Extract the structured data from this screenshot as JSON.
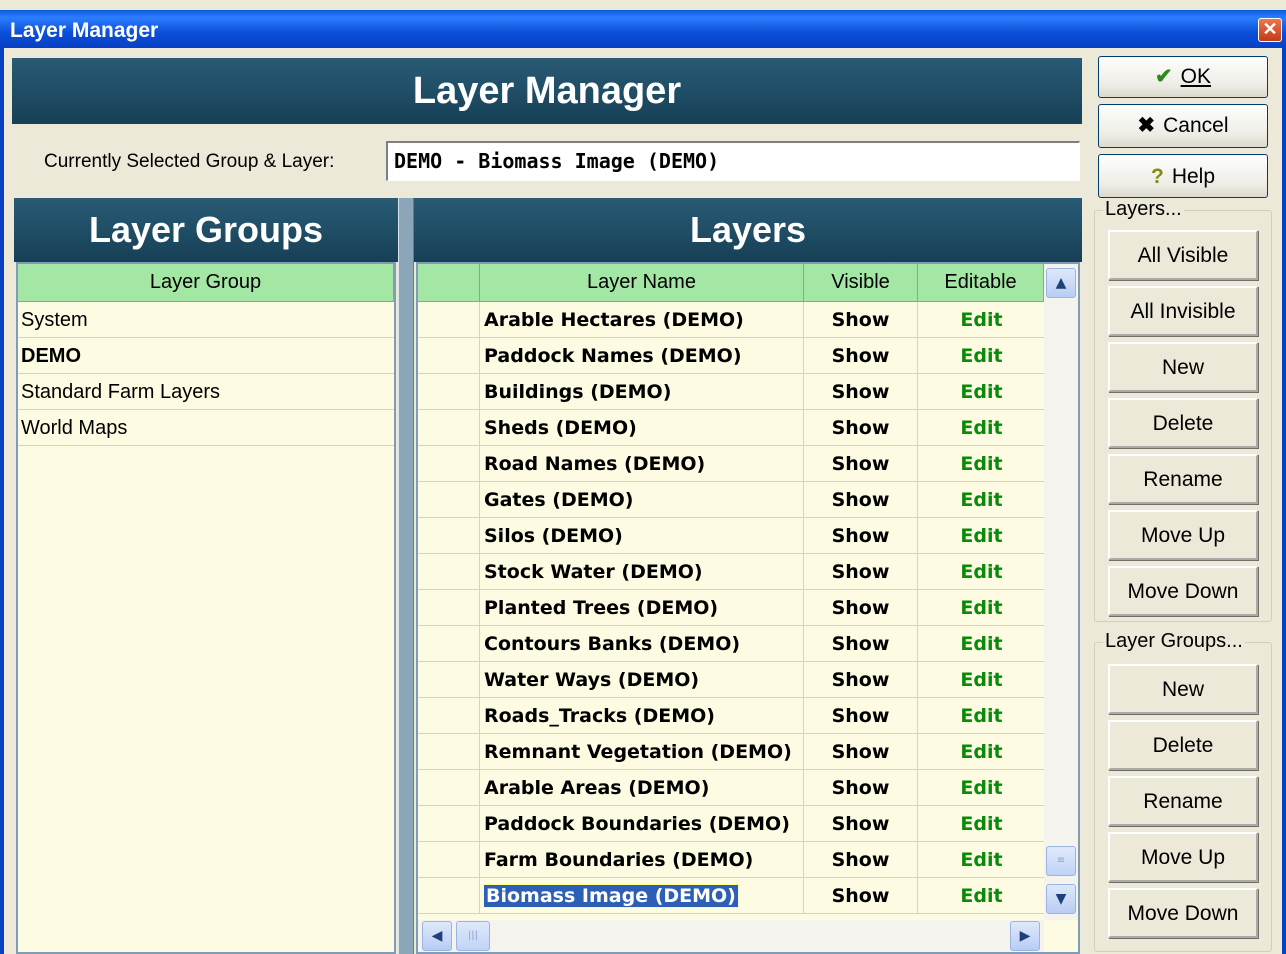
{
  "window": {
    "title": "Layer Manager",
    "close_glyph": "✕"
  },
  "header": {
    "title": "Layer Manager",
    "selected_label": "Currently Selected Group & Layer:",
    "selected_value": "DEMO - Biomass Image (DEMO)"
  },
  "groups_panel": {
    "title": "Layer Groups",
    "column_header": "Layer Group",
    "items": [
      {
        "label": "System",
        "bold": false
      },
      {
        "label": "DEMO",
        "bold": true
      },
      {
        "label": "Standard Farm Layers",
        "bold": false
      },
      {
        "label": "World Maps",
        "bold": false
      }
    ]
  },
  "layers_panel": {
    "title": "Layers",
    "columns": [
      "",
      "Layer Name",
      "Visible",
      "Editable"
    ],
    "rows": [
      {
        "name": "Arable Hectares (DEMO)",
        "visible": "Show",
        "editable": "Edit"
      },
      {
        "name": "Paddock Names (DEMO)",
        "visible": "Show",
        "editable": "Edit"
      },
      {
        "name": "Buildings  (DEMO)",
        "visible": "Show",
        "editable": "Edit"
      },
      {
        "name": "Sheds (DEMO)",
        "visible": "Show",
        "editable": "Edit"
      },
      {
        "name": "Road Names (DEMO)",
        "visible": "Show",
        "editable": "Edit"
      },
      {
        "name": "Gates (DEMO)",
        "visible": "Show",
        "editable": "Edit"
      },
      {
        "name": "Silos (DEMO)",
        "visible": "Show",
        "editable": "Edit"
      },
      {
        "name": "Stock Water (DEMO)",
        "visible": "Show",
        "editable": "Edit"
      },
      {
        "name": "Planted Trees (DEMO)",
        "visible": "Show",
        "editable": "Edit"
      },
      {
        "name": "Contours Banks (DEMO)",
        "visible": "Show",
        "editable": "Edit"
      },
      {
        "name": "Water Ways (DEMO)",
        "visible": "Show",
        "editable": "Edit"
      },
      {
        "name": "Roads_Tracks (DEMO)",
        "visible": "Show",
        "editable": "Edit"
      },
      {
        "name": "Remnant Vegetation (DEMO)",
        "visible": "Show",
        "editable": "Edit"
      },
      {
        "name": "Arable Areas (DEMO)",
        "visible": "Show",
        "editable": "Edit"
      },
      {
        "name": "Paddock Boundaries (DEMO)",
        "visible": "Show",
        "editable": "Edit"
      },
      {
        "name": "Farm Boundaries (DEMO)",
        "visible": "Show",
        "editable": "Edit"
      },
      {
        "name": "Biomass Image (DEMO)",
        "visible": "Show",
        "editable": "Edit",
        "selected": true
      }
    ],
    "selected_color": "#2d5fb6",
    "edit_color": "#0a8a0a"
  },
  "actions": {
    "ok": {
      "label": "OK",
      "icon": "check-icon"
    },
    "cancel": {
      "label": "Cancel",
      "icon": "x-icon"
    },
    "help": {
      "label": "Help",
      "icon": "question-icon"
    }
  },
  "layers_box": {
    "legend": "Layers...",
    "buttons": [
      "All Visible",
      "All Invisible",
      "New",
      "Delete",
      "Rename",
      "Move Up",
      "Move Down"
    ]
  },
  "groups_box": {
    "legend": "Layer Groups...",
    "buttons": [
      "New",
      "Delete",
      "Rename",
      "Move Up",
      "Move Down"
    ]
  },
  "colors": {
    "banner": "#1f4e66",
    "grid_header": "#a4e6a4",
    "grid_bg": "#fdfbe2"
  }
}
